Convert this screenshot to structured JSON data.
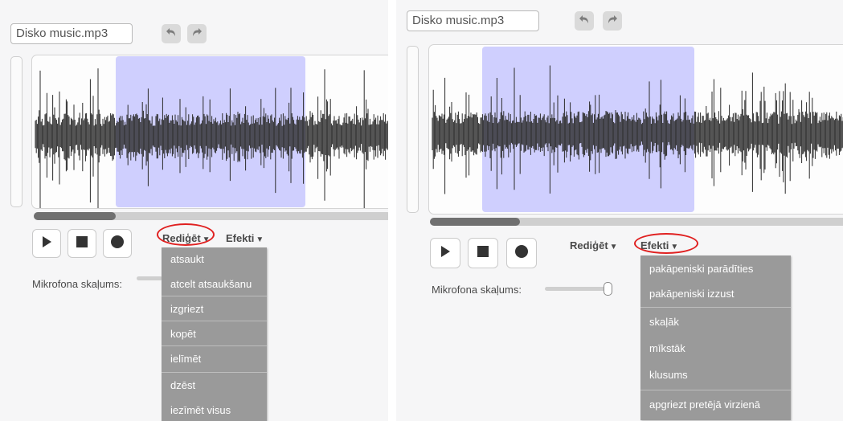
{
  "left": {
    "sound_name": "Disko music.mp3",
    "edit_menu_label": "Rediģēt",
    "effects_menu_label": "Efekti",
    "mic_label": "Mikrofona skaļums:",
    "edit_items": [
      "atsaukt",
      "atcelt atsaukšanu",
      "izgriezt",
      "kopēt",
      "ielīmēt",
      "dzēst",
      "iezīmēt visus"
    ]
  },
  "right": {
    "sound_name": "Disko music.mp3",
    "edit_menu_label": "Rediģēt",
    "effects_menu_label": "Efekti",
    "mic_label": "Mikrofona skaļums:",
    "effects_items": [
      "pakāpeniski parādīties",
      "pakāpeniski izzust",
      "skaļāk",
      "mīkstāk",
      "klusums",
      "apgriezt pretējā virzienā"
    ]
  },
  "highlight_color": "#e02020",
  "selection_color": "#9696ff",
  "icons": [
    "undo-icon",
    "redo-icon",
    "play-icon",
    "stop-icon",
    "record-icon",
    "dropdown-arrow-icon"
  ]
}
